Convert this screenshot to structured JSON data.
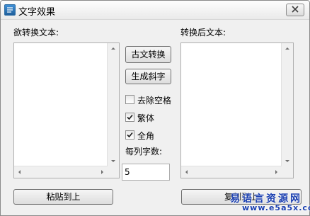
{
  "window": {
    "title": "文字效果"
  },
  "left_panel": {
    "label": "欲转换文本:",
    "text": ""
  },
  "right_panel": {
    "label": "转换后文本:",
    "text": ""
  },
  "buttons": {
    "ancient": "古文转换",
    "oblique": "生成斜字",
    "paste": "粘贴到上",
    "copy": "复制到上"
  },
  "options": {
    "remove_spaces": {
      "label": "去除空格",
      "checked": false
    },
    "traditional": {
      "label": "繁体",
      "checked": true
    },
    "fullwidth": {
      "label": "全角",
      "checked": true
    }
  },
  "per_column": {
    "label": "每列字数:",
    "value": "5"
  },
  "watermark": {
    "line1": "易语言资源网",
    "line2": "www.e5a5x.com"
  },
  "colors": {
    "watermark": "#1a3fb0"
  },
  "icons": {
    "app": "app-icon",
    "close": "close-icon"
  }
}
